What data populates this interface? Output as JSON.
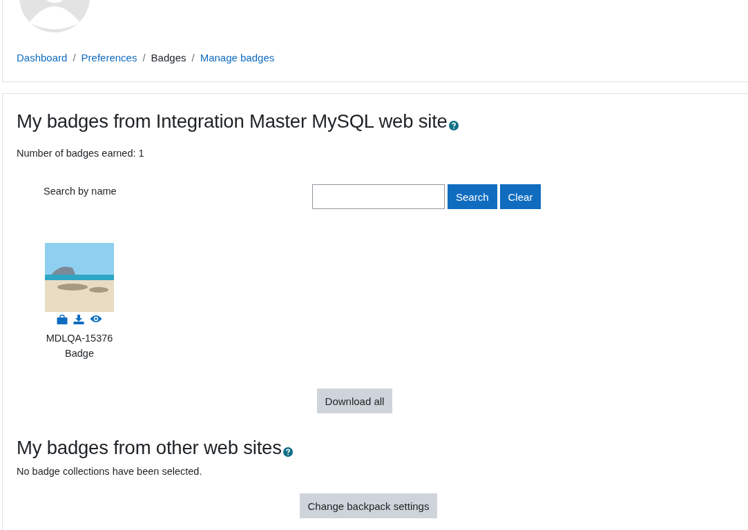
{
  "breadcrumb_separator": "/",
  "breadcrumbs": [
    {
      "label": "Dashboard",
      "kind": "link"
    },
    {
      "label": "Preferences",
      "kind": "link"
    },
    {
      "label": "Badges",
      "kind": "current"
    },
    {
      "label": "Manage badges",
      "kind": "link"
    }
  ],
  "sections": [
    {
      "title": "My badges from Integration Master MySQL web site",
      "summary": "Number of badges earned: 1"
    }
  ],
  "search": {
    "label": "Search by name",
    "buttons": [
      "Search",
      "Clear"
    ]
  },
  "badges": [
    {
      "name": "MDLQA-15376 Badge"
    }
  ],
  "download_button": "Download all",
  "other_section": {
    "title": "My badges from other web sites",
    "summary": "No badge collections have been selected.",
    "button": "Change backpack settings"
  }
}
